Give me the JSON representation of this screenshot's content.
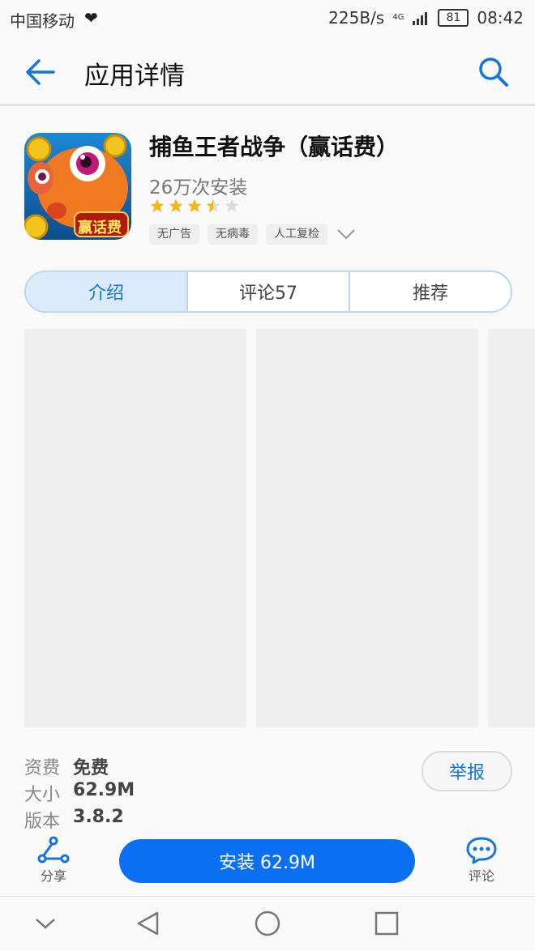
{
  "status_bar": {
    "carrier": "中国移动",
    "speed": "225B/s",
    "network": "4G",
    "battery": "81",
    "time": "08:42"
  },
  "header": {
    "title": "应用详情",
    "back_icon": "arrow-left-icon",
    "search_icon": "search-icon"
  },
  "app": {
    "name": "捕鱼王者战争（赢话费）",
    "installs": "26万次安装",
    "rating": 3.5,
    "rating_max": 5,
    "icon_badge": "赢话费",
    "tags": [
      "无广告",
      "无病毒",
      "人工复检"
    ]
  },
  "tabs": [
    {
      "label": "介绍",
      "active": true
    },
    {
      "label": "评论57",
      "active": false
    },
    {
      "label": "推荐",
      "active": false
    }
  ],
  "details": {
    "price_label": "资费",
    "price_value": "免费",
    "size_label": "大小",
    "size_value": "62.9M",
    "version_label": "版本",
    "version_value": "3.8.2",
    "report_label": "举报"
  },
  "bottom_bar": {
    "share_label": "分享",
    "install_label": "安装 62.9M",
    "comment_label": "评论"
  },
  "colors": {
    "accent": "#0a6ff3",
    "star": "#f5b81c",
    "star_empty": "#dddddd"
  }
}
